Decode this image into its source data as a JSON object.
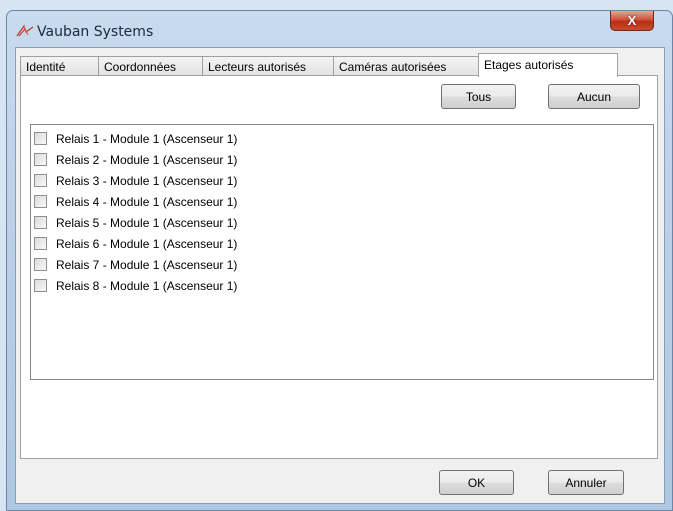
{
  "window": {
    "title": "Vauban Systems",
    "close_glyph": "X"
  },
  "tabs": [
    {
      "label": "Identité"
    },
    {
      "label": "Coordonnées"
    },
    {
      "label": "Lecteurs autorisés"
    },
    {
      "label": "Caméras autorisées"
    },
    {
      "label": "Etages autorisés",
      "active": true
    }
  ],
  "toolbar": {
    "all_label": "Tous",
    "none_label": "Aucun"
  },
  "floors": {
    "items": [
      {
        "label": "Relais 1 - Module 1 (Ascenseur 1)",
        "checked": false
      },
      {
        "label": "Relais 2 - Module 1 (Ascenseur 1)",
        "checked": false
      },
      {
        "label": "Relais 3 - Module 1 (Ascenseur 1)",
        "checked": false
      },
      {
        "label": "Relais 4 - Module 1 (Ascenseur 1)",
        "checked": false
      },
      {
        "label": "Relais 5 - Module 1 (Ascenseur 1)",
        "checked": false
      },
      {
        "label": "Relais 6 - Module 1 (Ascenseur 1)",
        "checked": false
      },
      {
        "label": "Relais 7 - Module 1 (Ascenseur 1)",
        "checked": false
      },
      {
        "label": "Relais 8 - Module 1 (Ascenseur 1)",
        "checked": false
      }
    ]
  },
  "footer": {
    "ok_label": "OK",
    "cancel_label": "Annuler"
  },
  "colors": {
    "accent": "#d0533b",
    "frame": "#bcd1e8",
    "client": "#f0f0f0"
  },
  "icons": {
    "app": "vauban-logo-icon",
    "close": "close-icon"
  }
}
